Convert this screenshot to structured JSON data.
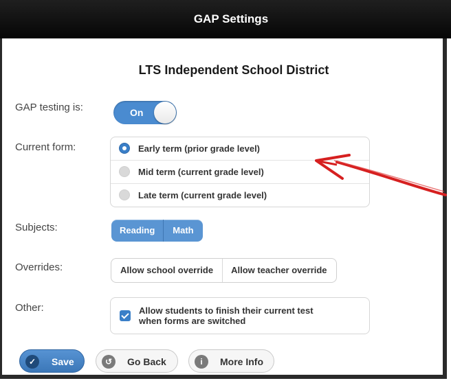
{
  "window": {
    "title": "GAP Settings"
  },
  "district": "LTS Independent School District",
  "gap_testing": {
    "label": "GAP testing is:",
    "toggle_text": "On",
    "enabled": true
  },
  "current_form": {
    "label": "Current form:",
    "options": [
      {
        "text": "Early term (prior grade level)",
        "selected": true
      },
      {
        "text": "Mid term (current grade level)",
        "selected": false
      },
      {
        "text": "Late term (current grade level)",
        "selected": false
      }
    ]
  },
  "subjects": {
    "label": "Subjects:",
    "options": [
      "Reading",
      "Math"
    ]
  },
  "overrides": {
    "label": "Overrides:",
    "options": [
      "Allow school override",
      "Allow teacher override"
    ]
  },
  "other": {
    "label": "Other:",
    "checkbox_line1": "Allow students to finish their current test",
    "checkbox_line2": "when forms are switched",
    "checked": true
  },
  "buttons": {
    "save": "Save",
    "go_back": "Go Back",
    "more_info": "More Info"
  },
  "colors": {
    "accent": "#4a8bd0",
    "annotation_arrow": "#d62020",
    "titlebar": "#0d0d0d"
  },
  "icons": {
    "save": "check-icon",
    "go_back": "back-arrow-icon",
    "more_info": "info-icon"
  }
}
